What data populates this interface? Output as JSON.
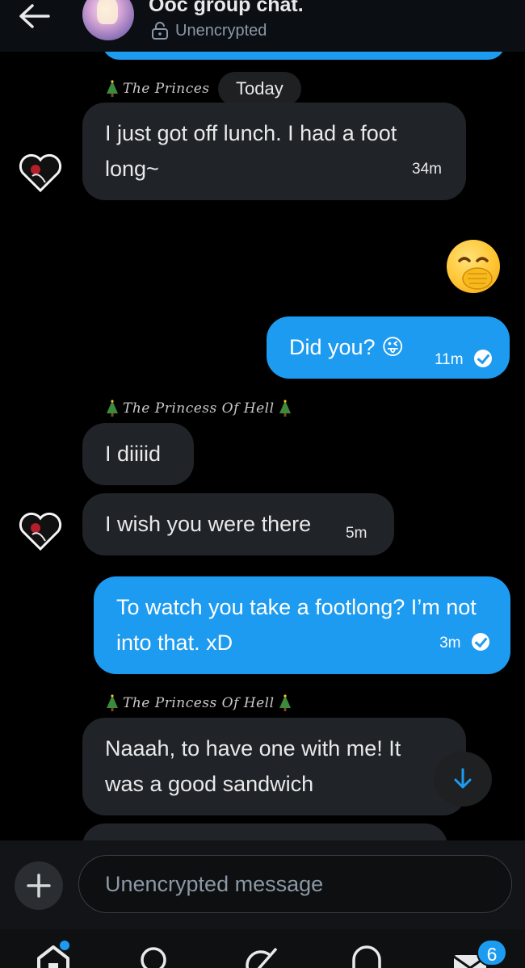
{
  "header": {
    "title": "Ooc group chat.",
    "encryption_status": "Unencrypted"
  },
  "date_separator": "Today",
  "messages": [
    {
      "type": "incoming",
      "sender": "The Princes",
      "text": "I just got off lunch. I had a foot long~",
      "time": "34m"
    },
    {
      "type": "outgoing",
      "emoji": "🤭"
    },
    {
      "type": "outgoing",
      "text": "Did you? 😜",
      "time": "11m",
      "read": true
    },
    {
      "type": "incoming",
      "sender": "The Princess Of Hell",
      "text": "I diiiid"
    },
    {
      "type": "incoming",
      "text": "I wish you were there",
      "time": "5m"
    },
    {
      "type": "outgoing",
      "text": "To watch you take a footlong? I’m not into that. xD",
      "time": "3m",
      "read": true
    },
    {
      "type": "incoming",
      "sender": "The Princess Of Hell",
      "text": "Naaah, to have one with me! It was a good sandwich"
    }
  ],
  "composer": {
    "placeholder": "Unencrypted message"
  },
  "tabbar": {
    "messages_badge": "6"
  },
  "colors": {
    "accent": "#1d9bf0",
    "incoming_bubble": "#202327",
    "background": "#000000"
  },
  "icons": [
    "back-arrow-icon",
    "lock-icon",
    "tree-icon",
    "checkmark-icon",
    "scroll-down-icon",
    "plus-icon",
    "home-icon",
    "search-icon",
    "grok-icon",
    "notifications-icon",
    "messages-icon"
  ]
}
